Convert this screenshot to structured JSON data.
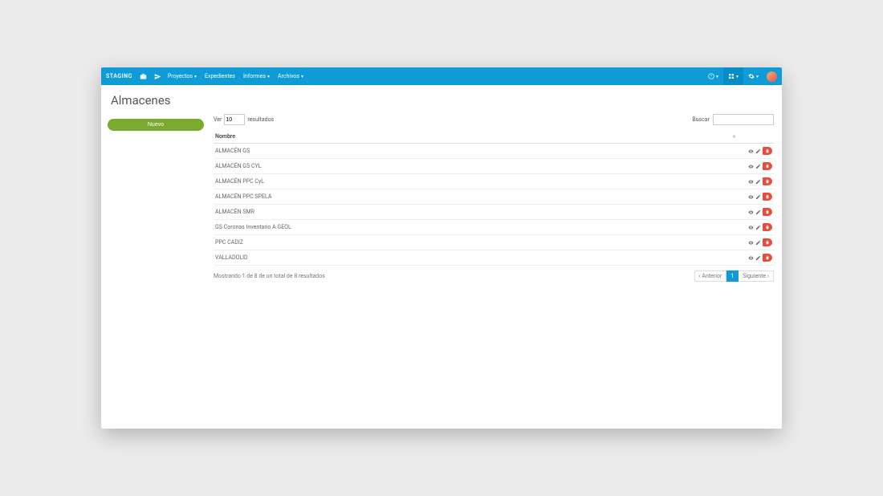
{
  "navbar": {
    "brand": "STAGING",
    "links": [
      {
        "label": "Proyectos",
        "dropdown": true
      },
      {
        "label": "Expedientes",
        "dropdown": false
      },
      {
        "label": "Informes",
        "dropdown": true
      },
      {
        "label": "Archivos",
        "dropdown": true
      }
    ]
  },
  "page": {
    "title": "Almacenes"
  },
  "sidebar": {
    "new_label": "Nuevo"
  },
  "table": {
    "length_prefix": "Ver",
    "length_value": "10",
    "length_suffix": "resultados",
    "search_label": "Buscar",
    "col_nombre": "Nombre",
    "rows": [
      {
        "nombre": "ALMACÉN GS"
      },
      {
        "nombre": "ALMACÉN GS CYL"
      },
      {
        "nombre": "ALMACÉN PPC CyL"
      },
      {
        "nombre": "ALMACÉN PPC SPELA"
      },
      {
        "nombre": "ALMACÉN SMR"
      },
      {
        "nombre": "GS Coronas Inventario A GEOL"
      },
      {
        "nombre": "PPC CADIZ"
      },
      {
        "nombre": "VALLADOLID"
      }
    ],
    "info": "Mostrando 1 de 8 de un total de 8 resultados",
    "pager": {
      "prev": "Anterior",
      "page": "1",
      "next": "Siguiente"
    }
  }
}
